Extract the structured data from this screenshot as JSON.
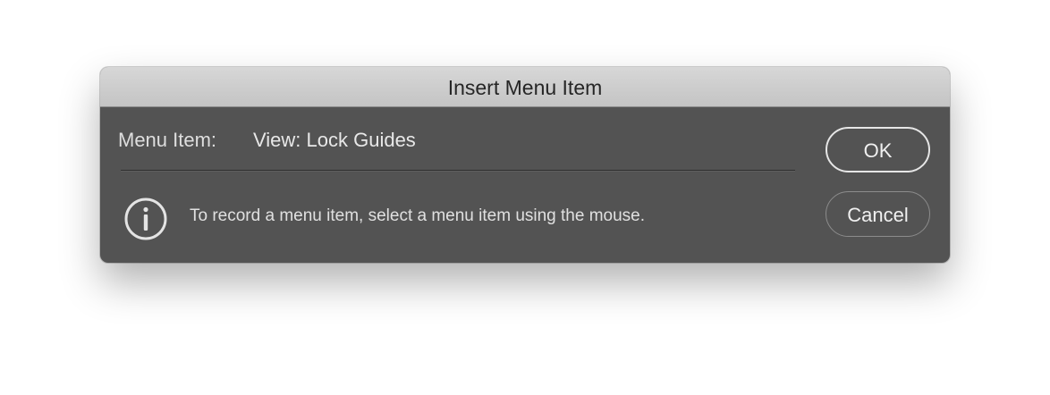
{
  "dialog": {
    "title": "Insert Menu Item",
    "menu_item_label": "Menu Item:",
    "menu_item_value": "View: Lock Guides",
    "info_icon": "info-circle-icon",
    "info_message": "To record a menu item, select a menu item using the mouse.",
    "ok_label": "OK",
    "cancel_label": "Cancel"
  },
  "colors": {
    "titlebar": "#c8c8c8",
    "body": "#535353",
    "text": "#e0e0e0"
  }
}
